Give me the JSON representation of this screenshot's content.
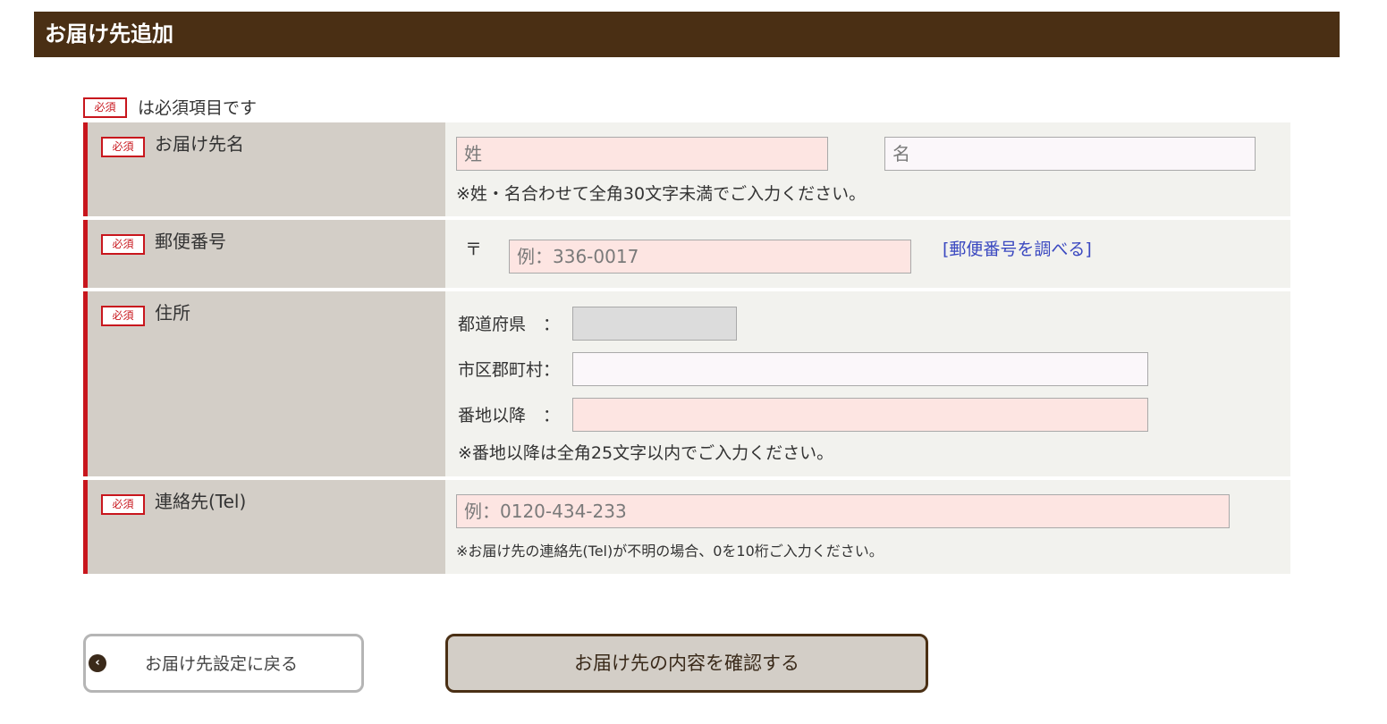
{
  "header": {
    "title": "お届け先追加"
  },
  "required": {
    "badge": "必須",
    "note": "は必須項目です"
  },
  "name_row": {
    "label": "お届け先名",
    "last_name_placeholder": "姓",
    "first_name_placeholder": "名",
    "hint": "※姓・名合わせて全角30文字未満でご入力ください。"
  },
  "postal_row": {
    "label": "郵便番号",
    "symbol": "〒",
    "placeholder": "例：336-0017",
    "lookup_link": "[郵便番号を調べる]"
  },
  "address_row": {
    "label": "住所",
    "prefecture_label": "都道府県　：",
    "city_label": "市区郡町村：",
    "street_label": "番地以降　：",
    "hint": "※番地以降は全角25文字以内でご入力ください。"
  },
  "tel_row": {
    "label": "連絡先(Tel)",
    "placeholder": "例：0120-434-233",
    "hint": "※お届け先の連絡先(Tel)が不明の場合、0を10桁ご入力ください。"
  },
  "buttons": {
    "back_label": "お届け先設定に戻る",
    "back_icon": "chevron-left-icon",
    "confirm_label": "お届け先の内容を確認する"
  },
  "colors": {
    "header_bg": "#4a2f14",
    "required_red": "#c8161d",
    "label_bg": "#d3cec7",
    "field_bg": "#f2f2ee",
    "input_pink": "#fde5e2",
    "link_blue": "#3a48c0"
  }
}
